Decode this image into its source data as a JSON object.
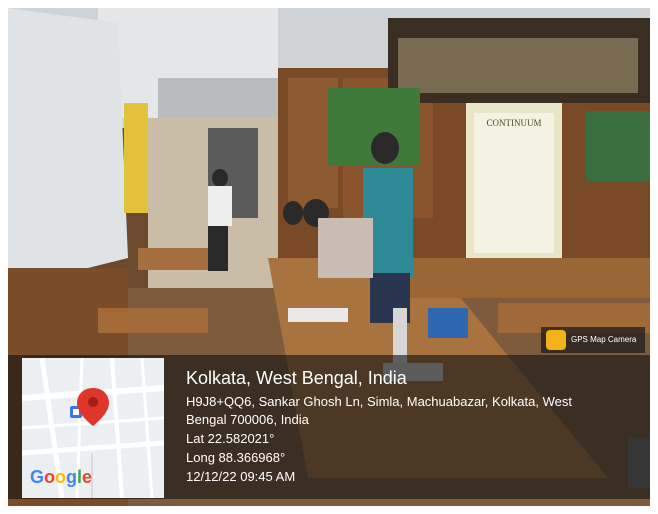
{
  "location": {
    "title": "Kolkata, West Bengal, India",
    "address": "H9J8+QQ6, Sankar Ghosh Ln, Simla, Machuabazar, Kolkata, West Bengal 700006, India",
    "lat": "Lat 22.582021°",
    "long": "Long 88.366968°",
    "datetime": "12/12/22 09:45 AM"
  },
  "map": {
    "provider": "Google",
    "pin_color": "#e0352b",
    "marker_icon": "map-pin-icon",
    "poi_icon": "building-poi-icon"
  },
  "badge": {
    "label": "GPS Map Camera",
    "icon": "camera-app-icon"
  },
  "scene": {
    "poster_label": "CONTINUUM"
  }
}
